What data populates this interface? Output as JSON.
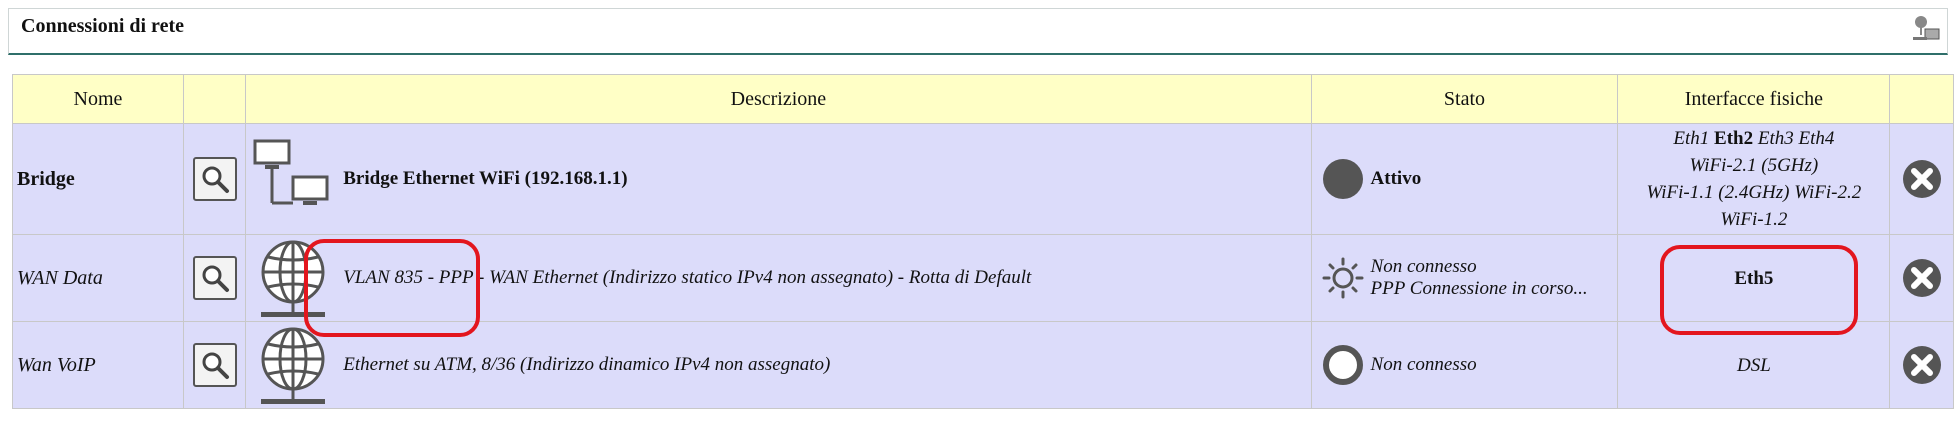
{
  "panel": {
    "title": "Connessioni di rete",
    "icon": "network-settings-icon"
  },
  "table": {
    "headers": {
      "name": "Nome",
      "view": "",
      "description": "Descrizione",
      "status": "Stato",
      "interfaces": "Interfacce fisiche",
      "delete": ""
    },
    "rows": [
      {
        "name": "Bridge",
        "description": "Bridge Ethernet WiFi (192.168.1.1)",
        "description_icon": "bridge-network-icon",
        "status_icon": "active-dot-icon",
        "status": "Attivo",
        "interfaces": {
          "line1_a": "Eth1",
          "line1_b": "Eth2",
          "line1_c": "Eth3 Eth4",
          "line2": "WiFi-2.1 (5GHz)",
          "line3": "WiFi-1.1 (2.4GHz) WiFi-2.2",
          "line4": "WiFi-1.2"
        }
      },
      {
        "name": "WAN Data",
        "description": "VLAN 835 - PPP - WAN Ethernet (Indirizzo statico IPv4 non assegnato) - Rotta di Default",
        "description_icon": "globe-network-icon",
        "status_icon": "connecting-sun-icon",
        "status_line1": "Non connesso",
        "status_line2": "PPP Connessione in corso...",
        "interfaces": "Eth5"
      },
      {
        "name": "Wan VoIP",
        "description": "Ethernet su ATM, 8/36 (Indirizzo dinamico IPv4 non assegnato)",
        "description_icon": "globe-network-icon",
        "status_icon": "inactive-ring-icon",
        "status": "Non connesso",
        "interfaces": "DSL"
      }
    ]
  },
  "colors": {
    "header_bg": "#ffffc6",
    "row_bg": "#dcdcfa",
    "highlight": "#e3161e",
    "accent_line": "#2f6f6a"
  }
}
